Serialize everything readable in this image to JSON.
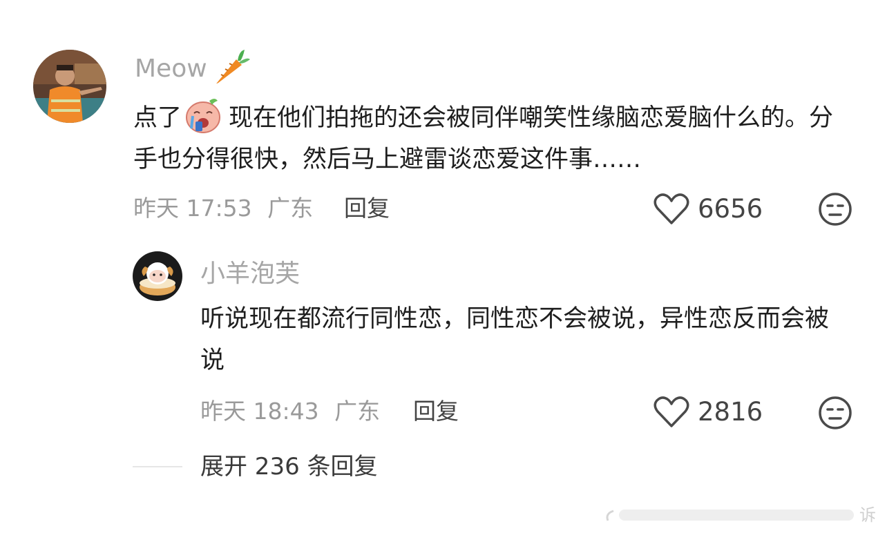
{
  "comments": [
    {
      "username": "Meow",
      "username_emoji": "carrot-icon",
      "text_parts": [
        "点了",
        "现在他们拍拖的还会被同伴嘲笑性缘脑恋爱脑什么的。分手也分得很快，然后马上避雷谈恋爱这件事……"
      ],
      "inline_emoji": "crying-face-sticker-icon",
      "time": "昨天 17:53",
      "location": "广东",
      "reply_label": "回复",
      "likes": "6656"
    },
    {
      "username": "小羊泡芙",
      "text": "听说现在都流行同性恋，同性恋不会被说，异性恋反而会被说",
      "time": "昨天 18:43",
      "location": "广东",
      "reply_label": "回复",
      "likes": "2816"
    }
  ],
  "expand_replies_label": "展开 236 条回复",
  "colors": {
    "username": "#a6a6a6",
    "text": "#1e1e1e",
    "meta": "#9a9a9a",
    "icon": "#4a4a4a"
  }
}
